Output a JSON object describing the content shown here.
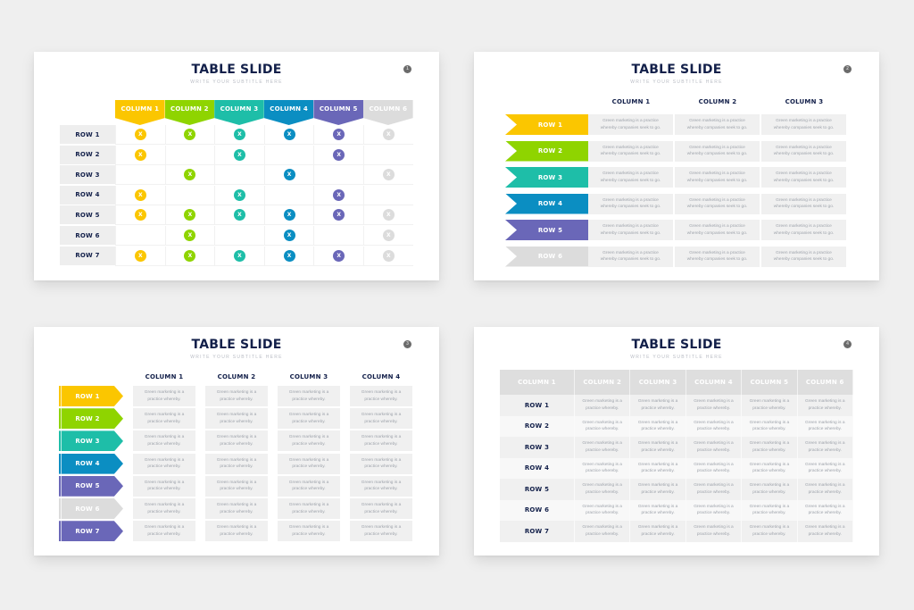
{
  "colors": {
    "yellow": "#fbc600",
    "green": "#8fd400",
    "teal": "#1ebea8",
    "blue": "#0b8ec2",
    "purple": "#6a67b8",
    "gray": "#dcdcdc",
    "navy": "#13204a"
  },
  "slides": [
    {
      "title": "TABLE SLIDE",
      "subtitle": "WRITE YOUR SUBTITLE HERE",
      "page_number": "1",
      "columns": [
        "COLUMN 1",
        "COLUMN 2",
        "COLUMN 3",
        "COLUMN 4",
        "COLUMN 5",
        "COLUMN 6"
      ],
      "rows": [
        "ROW 1",
        "ROW 2",
        "ROW 3",
        "ROW 4",
        "ROW 5",
        "ROW 6",
        "ROW 7"
      ],
      "mark_symbol": "X",
      "matrix": [
        [
          1,
          1,
          1,
          1,
          1,
          1
        ],
        [
          1,
          0,
          1,
          0,
          1,
          0
        ],
        [
          0,
          1,
          0,
          1,
          0,
          1
        ],
        [
          1,
          0,
          1,
          0,
          1,
          0
        ],
        [
          1,
          1,
          1,
          1,
          1,
          1
        ],
        [
          0,
          1,
          0,
          1,
          0,
          1
        ],
        [
          1,
          1,
          1,
          1,
          1,
          1
        ]
      ]
    },
    {
      "title": "TABLE SLIDE",
      "subtitle": "WRITE YOUR SUBTITLE HERE",
      "page_number": "2",
      "columns": [
        "COLUMN 1",
        "COLUMN 2",
        "COLUMN 3"
      ],
      "rows": [
        "ROW 1",
        "ROW 2",
        "ROW 3",
        "ROW 4",
        "ROW 5",
        "ROW 6"
      ],
      "cell_text": "Green marketing is a practice whereby companies seek to go."
    },
    {
      "title": "TABLE SLIDE",
      "subtitle": "WRITE YOUR SUBTITLE HERE",
      "page_number": "3",
      "columns": [
        "COLUMN 1",
        "COLUMN 2",
        "COLUMN 3",
        "COLUMN 4"
      ],
      "rows": [
        "ROW 1",
        "ROW 2",
        "ROW 3",
        "ROW 4",
        "ROW 5",
        "ROW 6",
        "ROW 7"
      ],
      "cell_text": "Green marketing is a practice whereby."
    },
    {
      "title": "TABLE SLIDE",
      "subtitle": "WRITE YOUR SUBTITLE HERE",
      "page_number": "4",
      "columns": [
        "COLUMN 1",
        "COLUMN 2",
        "COLUMN 3",
        "COLUMN 4",
        "COLUMN 5",
        "COLUMN 6"
      ],
      "rows": [
        "ROW 1",
        "ROW 2",
        "ROW 3",
        "ROW 4",
        "ROW 5",
        "ROW 6",
        "ROW 7"
      ],
      "cell_text": "Green marketing is a practice whereby."
    }
  ],
  "palette_order": [
    "yellow",
    "green",
    "teal",
    "blue",
    "purple",
    "gray",
    "purple"
  ]
}
